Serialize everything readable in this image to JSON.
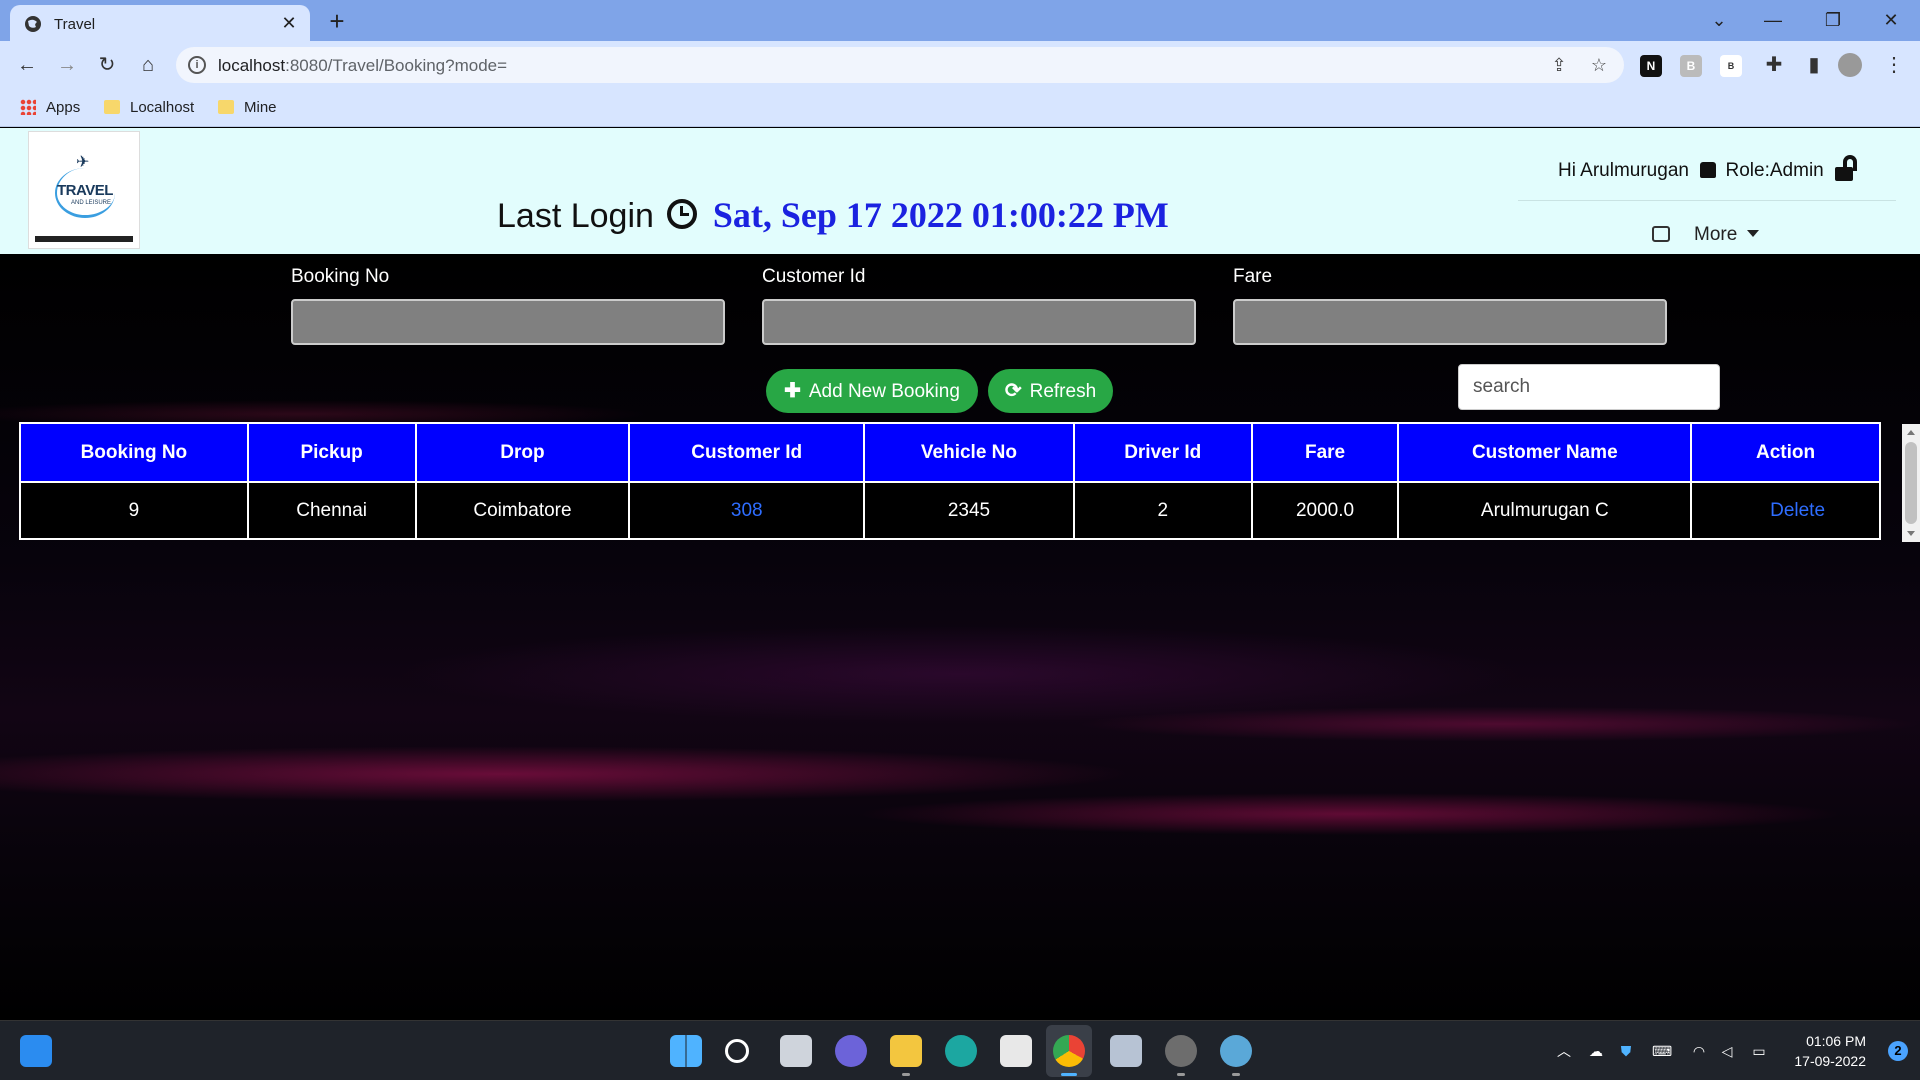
{
  "browser": {
    "tab_title": "Travel",
    "url_host": "localhost",
    "url_path": ":8080/Travel/Booking?mode=",
    "bookmarks": [
      "Apps",
      "Localhost",
      "Mine"
    ],
    "extension_labels": [
      "B",
      "B"
    ]
  },
  "header": {
    "logo_text": "TRAVEL",
    "logo_sub": "AND LEISURE",
    "last_login_label": "Last Login",
    "last_login_time": "Sat, Sep 17 2022 01:00:22 PM",
    "greeting": "Hi Arulmurugan",
    "role": "Role:Admin",
    "more_label": "More"
  },
  "form": {
    "booking_no_label": "Booking No",
    "customer_id_label": "Customer Id",
    "fare_label": "Fare",
    "booking_no_value": "",
    "customer_id_value": "",
    "fare_value": ""
  },
  "actions": {
    "add_label": "Add New Booking",
    "refresh_label": "Refresh",
    "search_placeholder": "search"
  },
  "table": {
    "headers": [
      "Booking No",
      "Pickup",
      "Drop",
      "Customer Id",
      "Vehicle No",
      "Driver Id",
      "Fare",
      "Customer Name",
      "Action"
    ],
    "rows": [
      [
        "9",
        "Chennai",
        "Coimbatore",
        "308",
        "2345",
        "2",
        "2000.0",
        "Arulmurugan C",
        "Delete"
      ]
    ]
  },
  "taskbar": {
    "time": "01:06 PM",
    "date": "17-09-2022",
    "notification_count": "2"
  },
  "colors": {
    "header_bg": "#e2fdfd",
    "login_time": "#1b22e0",
    "table_header_bg": "#0000ff",
    "button_green": "#28a745",
    "link_blue": "#2e6dff"
  }
}
